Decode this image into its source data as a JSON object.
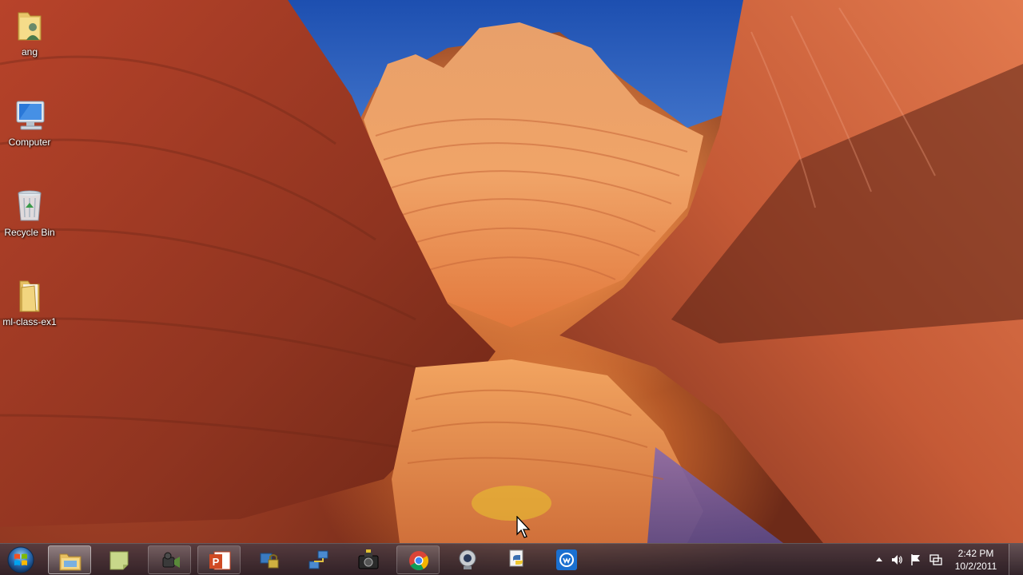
{
  "desktop": {
    "icons": [
      {
        "label": "ang",
        "icon": "user-folder-icon"
      },
      {
        "label": "Computer",
        "icon": "computer-icon"
      },
      {
        "label": "Recycle Bin",
        "icon": "recycle-bin-icon"
      },
      {
        "label": "ml-class-ex1",
        "icon": "folder-icon"
      }
    ]
  },
  "taskbar": {
    "start_icon": "windows-start-icon",
    "buttons": [
      {
        "icon": "file-explorer-icon",
        "state": "active"
      },
      {
        "icon": "sticky-notes-icon",
        "state": "normal"
      },
      {
        "icon": "camcorder-icon",
        "state": "open"
      },
      {
        "icon": "powerpoint-icon",
        "state": "open"
      },
      {
        "icon": "network-lock-icon",
        "state": "normal"
      },
      {
        "icon": "network-connect-icon",
        "state": "normal"
      },
      {
        "icon": "camera-icon",
        "state": "normal"
      },
      {
        "icon": "chrome-icon",
        "state": "open"
      },
      {
        "icon": "webcam-icon",
        "state": "normal"
      },
      {
        "icon": "python-icon",
        "state": "normal"
      },
      {
        "icon": "webex-icon",
        "state": "normal"
      }
    ],
    "tray": {
      "icons": [
        "show-hidden-icons-icon",
        "volume-icon",
        "action-center-flag-icon",
        "network-icon"
      ],
      "time": "2:42 PM",
      "date": "10/2/2011"
    }
  },
  "colors": {
    "taskbar_bg": "#2c2630",
    "sky": "#2a5fb8",
    "sandstone": "#e07a40"
  }
}
